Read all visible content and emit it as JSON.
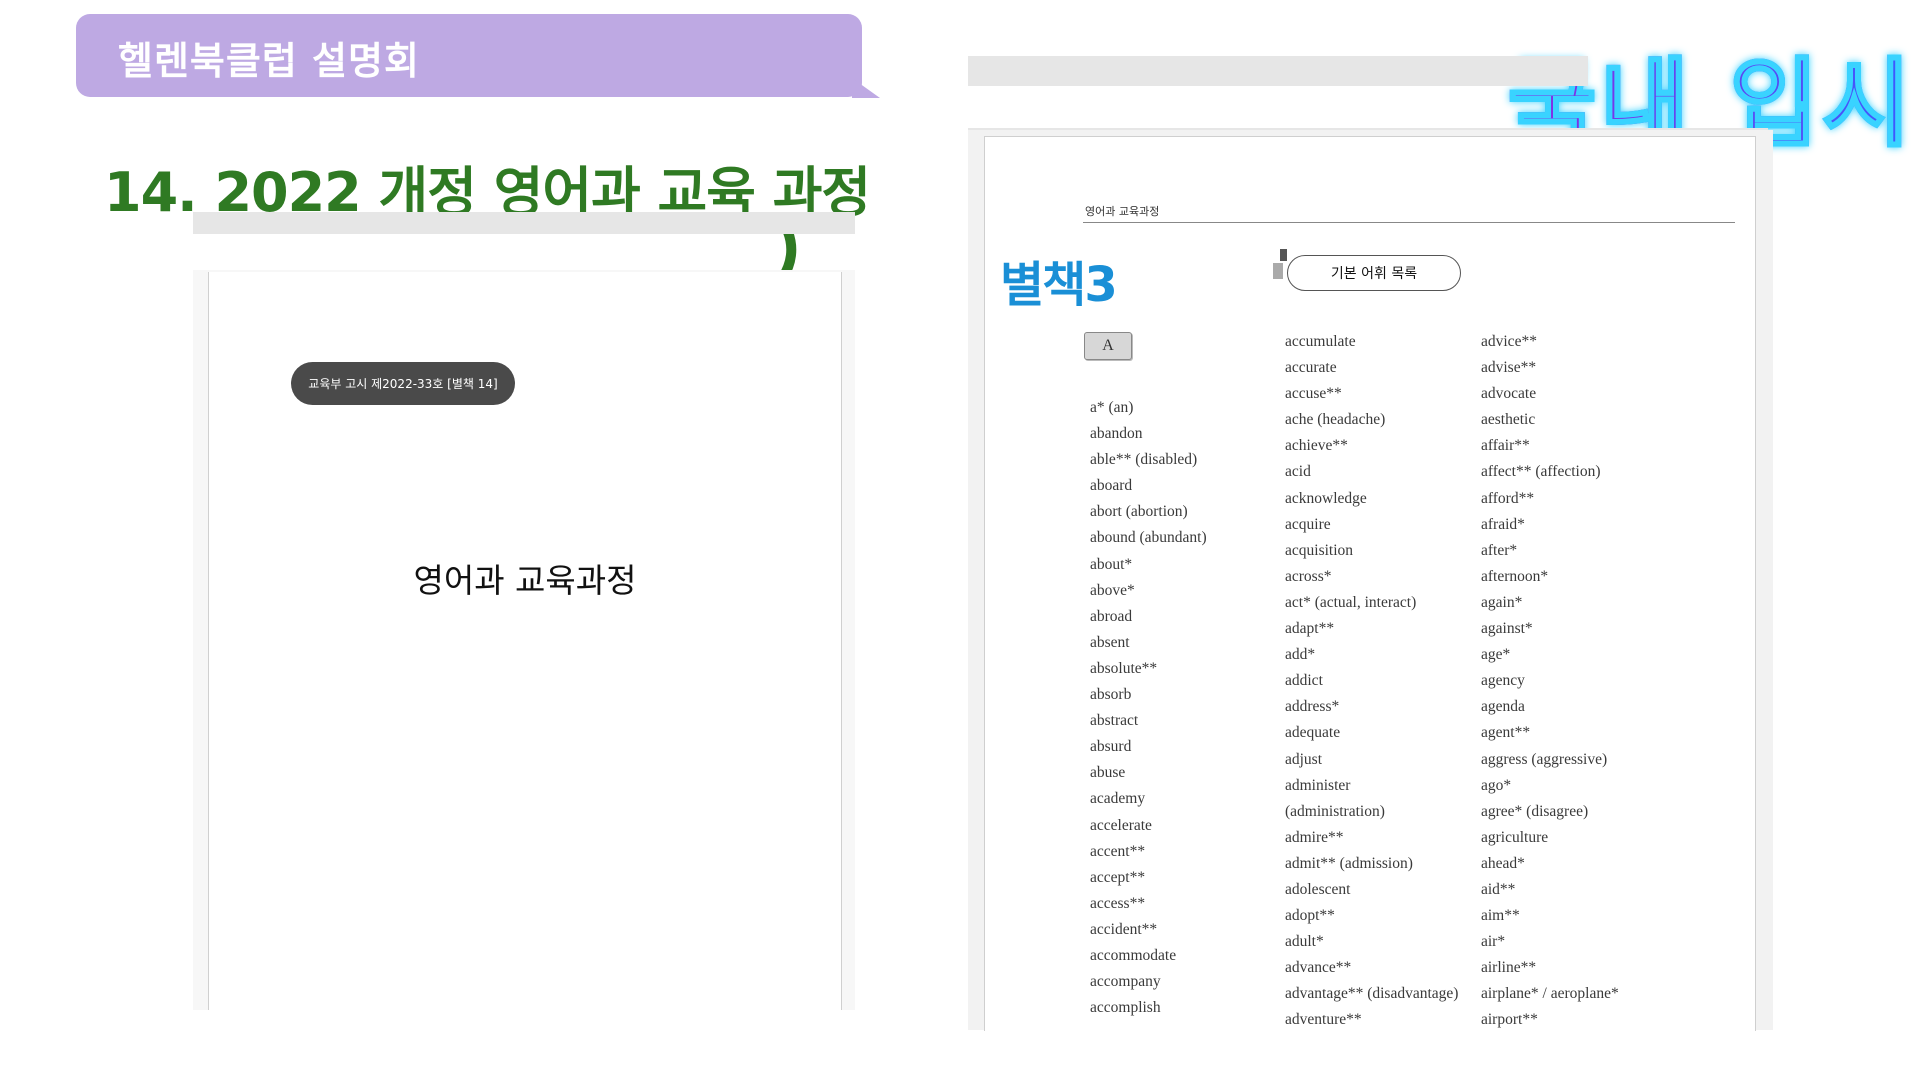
{
  "header": {
    "banner_title": "헬렌북클럽 설명회",
    "main_title": "14. 2022 개정 영어과 교육 과정",
    "corner_label": "국내 입시"
  },
  "left_document": {
    "notice": "교육부 고시 제2022-33호 [별책 14]",
    "title": "영어과 교육과정"
  },
  "right_document": {
    "running_head": "영어과 교육과정",
    "appendix_label": "별책3",
    "section_tag": "기본 어휘 목록",
    "letter": "A",
    "columns": [
      [
        "a* (an)",
        "abandon",
        "able** (disabled)",
        "aboard",
        "abort (abortion)",
        "abound (abundant)",
        "about*",
        "above*",
        "abroad",
        "absent",
        "absolute**",
        "absorb",
        "abstract",
        "absurd",
        "abuse",
        "academy",
        "accelerate",
        "accent**",
        "accept**",
        "access**",
        "accident**",
        "accommodate",
        "accompany",
        "accomplish"
      ],
      [
        "accumulate",
        "accurate",
        "accuse**",
        "ache (headache)",
        "achieve**",
        "acid",
        "acknowledge",
        "acquire",
        "acquisition",
        "across*",
        "act* (actual, interact)",
        "adapt**",
        "add*",
        "addict",
        "address*",
        "adequate",
        "adjust",
        "administer",
        "(administration)",
        "admire**",
        "admit** (admission)",
        "adolescent",
        "adopt**",
        "adult*",
        "advance**",
        "advantage** (disadvantage)",
        "adventure**"
      ],
      [
        "advice**",
        "advise**",
        "advocate",
        "aesthetic",
        "affair**",
        "affect** (affection)",
        "afford**",
        "afraid*",
        "after*",
        "afternoon*",
        "again*",
        "against*",
        "age*",
        "agency",
        "agenda",
        "agent**",
        "aggress (aggressive)",
        "ago*",
        "agree* (disagree)",
        "agriculture",
        "ahead*",
        "aid**",
        "aim**",
        "air*",
        "airline**",
        "airplane* / aeroplane*",
        "airport**"
      ]
    ]
  },
  "colors": {
    "banner": "#bea9e3",
    "title_green": "#2f7a23",
    "appendix_blue": "#1a8fd6",
    "corner_purple": "#8a2be2",
    "corner_glow": "#39d3ff"
  }
}
